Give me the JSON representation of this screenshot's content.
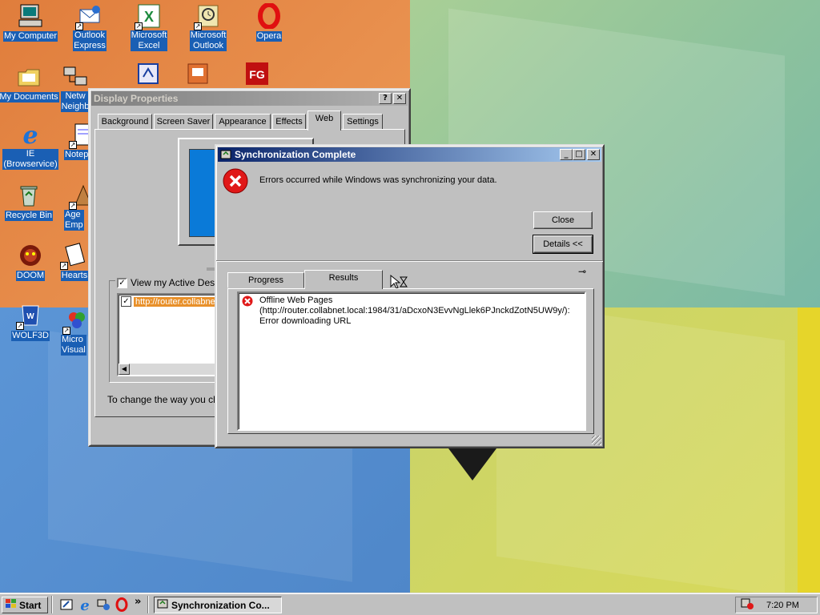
{
  "desktop": {
    "icons": [
      {
        "label": "My Computer",
        "icon": "my-computer-icon"
      },
      {
        "label": "Outlook\nExpress",
        "icon": "outlook-express-icon"
      },
      {
        "label": "Microsoft\nExcel",
        "icon": "excel-icon"
      },
      {
        "label": "Microsoft\nOutlook",
        "icon": "outlook-icon"
      },
      {
        "label": "Opera",
        "icon": "opera-icon"
      },
      {
        "label": "My Documents",
        "icon": "folder-icon"
      },
      {
        "label": "Netw\nNeighb",
        "icon": "network-icon"
      },
      {
        "label": "IE\n(Browservice)",
        "icon": "ie-icon"
      },
      {
        "label": "Notep",
        "icon": "notepad-icon"
      },
      {
        "label": "Recycle Bin",
        "icon": "recycle-bin-icon"
      },
      {
        "label": "Age\nEmp",
        "icon": "age-of-empires-icon"
      },
      {
        "label": "DOOM",
        "icon": "doom-icon"
      },
      {
        "label": "Hearts",
        "icon": "hearts-icon"
      },
      {
        "label": "WOLF3D",
        "icon": "wolf3d-icon"
      },
      {
        "label": "Micro\nVisual",
        "icon": "visual-studio-icon"
      }
    ]
  },
  "display_properties": {
    "title": "Display Properties",
    "help_btn": "?",
    "close_btn": "✕",
    "tabs": [
      "Background",
      "Screen Saver",
      "Appearance",
      "Effects",
      "Web",
      "Settings"
    ],
    "selected_tab": "Web",
    "view_active_desktop": "View my Active Deskto",
    "list_item": "http://router.collabne",
    "footer_text": "To change the way you click"
  },
  "sync_dialog": {
    "title": "Synchronization Complete",
    "message": "Errors occurred while Windows was synchronizing your data.",
    "close_btn": "Close",
    "details_btn": "Details <<",
    "tabs": [
      "Progress",
      "Results"
    ],
    "selected_tab": "Results",
    "results": [
      {
        "line1": "Offline Web Pages",
        "line2": "(http://router.collabnet.local:1984/31/aDcxoN3EvvNgLlek6PJnckdZotN5UW9y/):",
        "line3": "Error downloading URL"
      }
    ]
  },
  "taskbar": {
    "start_label": "Start",
    "chevron": "»",
    "task_label": "Synchronization Co...",
    "clock": "7:20 PM"
  }
}
